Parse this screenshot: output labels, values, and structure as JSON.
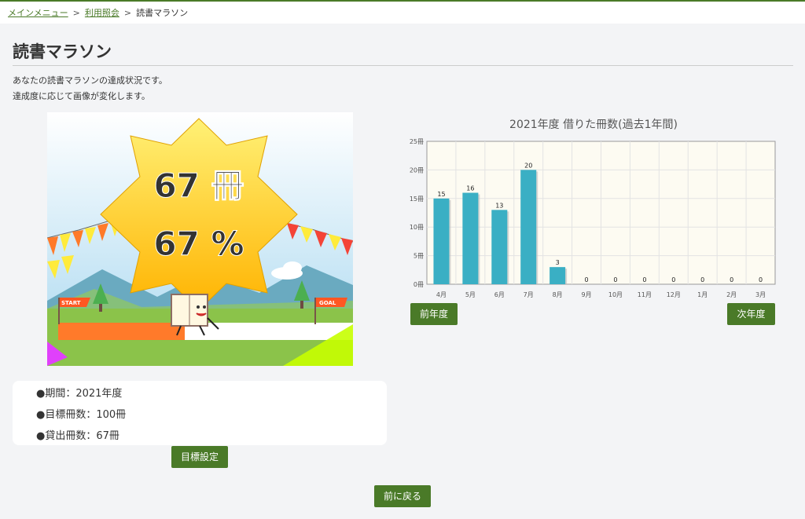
{
  "breadcrumb": {
    "items": [
      {
        "label": "メインメニュー"
      },
      {
        "label": "利用照会"
      },
      {
        "label": "読書マラソン"
      }
    ],
    "separator": ">"
  },
  "page": {
    "title": "読書マラソン",
    "description": [
      "あなたの読書マラソンの達成状況です。",
      "達成度に応じて画像が変化します。"
    ]
  },
  "banner": {
    "books_text": "67 冊",
    "percent_text": "67 %",
    "start_label": "START",
    "goal_label": "GOAL",
    "progress": 0.67
  },
  "info": {
    "period": "●期間：2021年度",
    "target": "●目標冊数：100冊",
    "borrowed": "●貸出冊数：67冊"
  },
  "buttons": {
    "prev_year": "前年度",
    "next_year": "次年度",
    "goal_setting": "目標設定",
    "back": "前に戻る"
  },
  "colors": {
    "accent": "#4a7a28",
    "bar": "#3aafc4",
    "plot_bg": "#fdfbf2"
  },
  "chart_data": {
    "type": "bar",
    "title": "2021年度 借りた冊数(過去1年間)",
    "categories": [
      "4月",
      "5月",
      "6月",
      "7月",
      "8月",
      "9月",
      "10月",
      "11月",
      "12月",
      "1月",
      "2月",
      "3月"
    ],
    "values": [
      15,
      16,
      13,
      20,
      3,
      0,
      0,
      0,
      0,
      0,
      0,
      0
    ],
    "yticks": [
      "0冊",
      "5冊",
      "10冊",
      "15冊",
      "20冊",
      "25冊"
    ],
    "ylim": [
      0,
      25
    ],
    "grid": true
  }
}
